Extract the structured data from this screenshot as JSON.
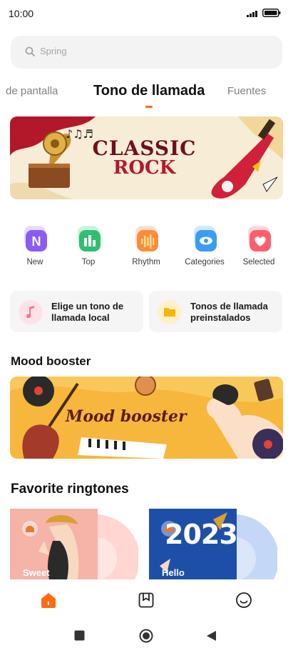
{
  "status": {
    "time": "10:00"
  },
  "search": {
    "placeholder": "Spring"
  },
  "tabs": [
    {
      "label": "de pantalla"
    },
    {
      "label": "Tono de llamada"
    },
    {
      "label": "Fuentes"
    }
  ],
  "banner": {
    "title_line1": "CLASSIC",
    "title_line2": "ROCK"
  },
  "categories": [
    {
      "label": "New",
      "icon": "n-badge-icon",
      "color": "#8a5cf6"
    },
    {
      "label": "Top",
      "icon": "bar-chart-icon",
      "color": "#2fbf71"
    },
    {
      "label": "Rhythm",
      "icon": "waveform-icon",
      "color": "#ff8a3d"
    },
    {
      "label": "Categories",
      "icon": "eye-icon",
      "color": "#3a9cf2"
    },
    {
      "label": "Selected",
      "icon": "heart-icon",
      "color": "#ff5d6c"
    }
  ],
  "quick_cards": [
    {
      "label": "Elige un tono de llamada local",
      "icon": "music-note-icon"
    },
    {
      "label": "Tonos de llamada preinstalados",
      "icon": "folder-icon"
    }
  ],
  "sections": {
    "mood": "Mood booster",
    "mood_banner_text": "Mood booster",
    "favorites": "Favorite ringtones"
  },
  "favorites": [
    {
      "label": "Sweet"
    },
    {
      "label": "Hello",
      "art_text": "2023"
    }
  ],
  "colors": {
    "accent": "#ff6a13"
  }
}
